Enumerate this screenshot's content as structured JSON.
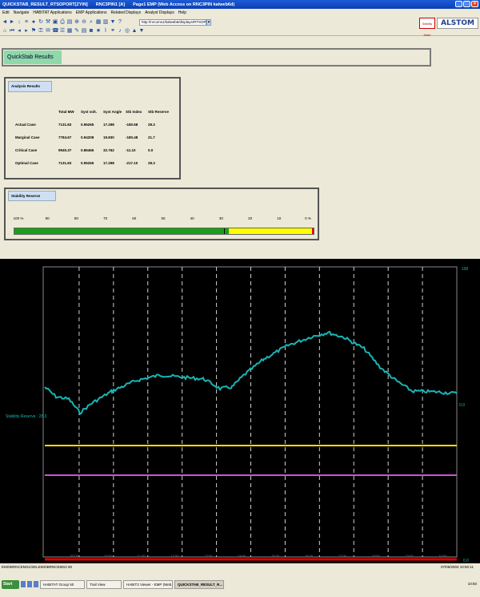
{
  "window": {
    "title_segments": [
      "QUICKSTAB_RESULT_RTSOPORT[ZYIN]",
      "RNC3PIN1 [A]",
      "Page1 EMP (Web Access on RNC3PIN kalweb6d)"
    ]
  },
  "menu": [
    "Edit",
    "Navigate",
    "HABITAT Applications",
    "EMP Applications",
    "Related Displays",
    "Analyst Displays",
    "Help"
  ],
  "toolbar": {
    "address": "http://nrcoms1/kalweb6/displays/RTSOPORT.Kj"
  },
  "branding": {
    "small_logo": "Stability Made Simple",
    "company": "ALSTOM"
  },
  "page_title": "QuickStab Results",
  "analysis": {
    "title": "Analysis Results",
    "headers": [
      "",
      "Total MW",
      "Syst volt.",
      "Syst Angle",
      "Stb Index",
      "Stb Reserve"
    ],
    "rows": [
      [
        "Actual Case",
        "7131.83",
        "0.95265",
        "17.298",
        "-180.68",
        "28.3"
      ],
      [
        "Marginal Case",
        "7784.67",
        "0.94208",
        "19.830",
        "-180.48",
        "21.7"
      ],
      [
        "Critical Case",
        "9945.37",
        "0.86466",
        "32.762",
        "-11.10",
        "0.0"
      ],
      [
        "Optimal Case",
        "7131.83",
        "0.95265",
        "17.298",
        "-217.10",
        "28.3"
      ]
    ]
  },
  "stability": {
    "title": "Stability Reserve",
    "scale_labels": [
      "100 %",
      "90",
      "80",
      "70",
      "60",
      "50",
      "40",
      "30",
      "20",
      "10",
      "0 %"
    ],
    "reserve_percent": 28.3,
    "marker_percent": 30,
    "colors": {
      "green": "#1a9e1a",
      "yellow": "#ffff00",
      "red": "#e00000"
    }
  },
  "trend": {
    "left_label": "Stability Reserve : 28.3",
    "right_top": "100",
    "right_bottom": "0.0",
    "x_labels": [
      "09:00",
      "10:00",
      "11:00",
      "12:00",
      "13:00",
      "14:00",
      "15:00",
      "16:00",
      "17:00",
      "18:00",
      "19:00",
      "10:50"
    ],
    "colors": {
      "trend": "#19b5b5",
      "yellow": "#ffe000",
      "magenta": "#cc55cc",
      "red": "#e00000"
    }
  },
  "status": {
    "left": "EMS\\BRNCEMS1\\SELEMS\\BRNCEMS2 50",
    "right": "07/05/2004 10:50:11"
  },
  "taskbar": {
    "start": "Start",
    "tasks": [
      "HABITAT Group 50",
      "Trail View",
      "HABIT2 Viewer - EMP (Web...",
      "QUICKSTAB_RESULT_R..."
    ],
    "clock": "10:50"
  }
}
